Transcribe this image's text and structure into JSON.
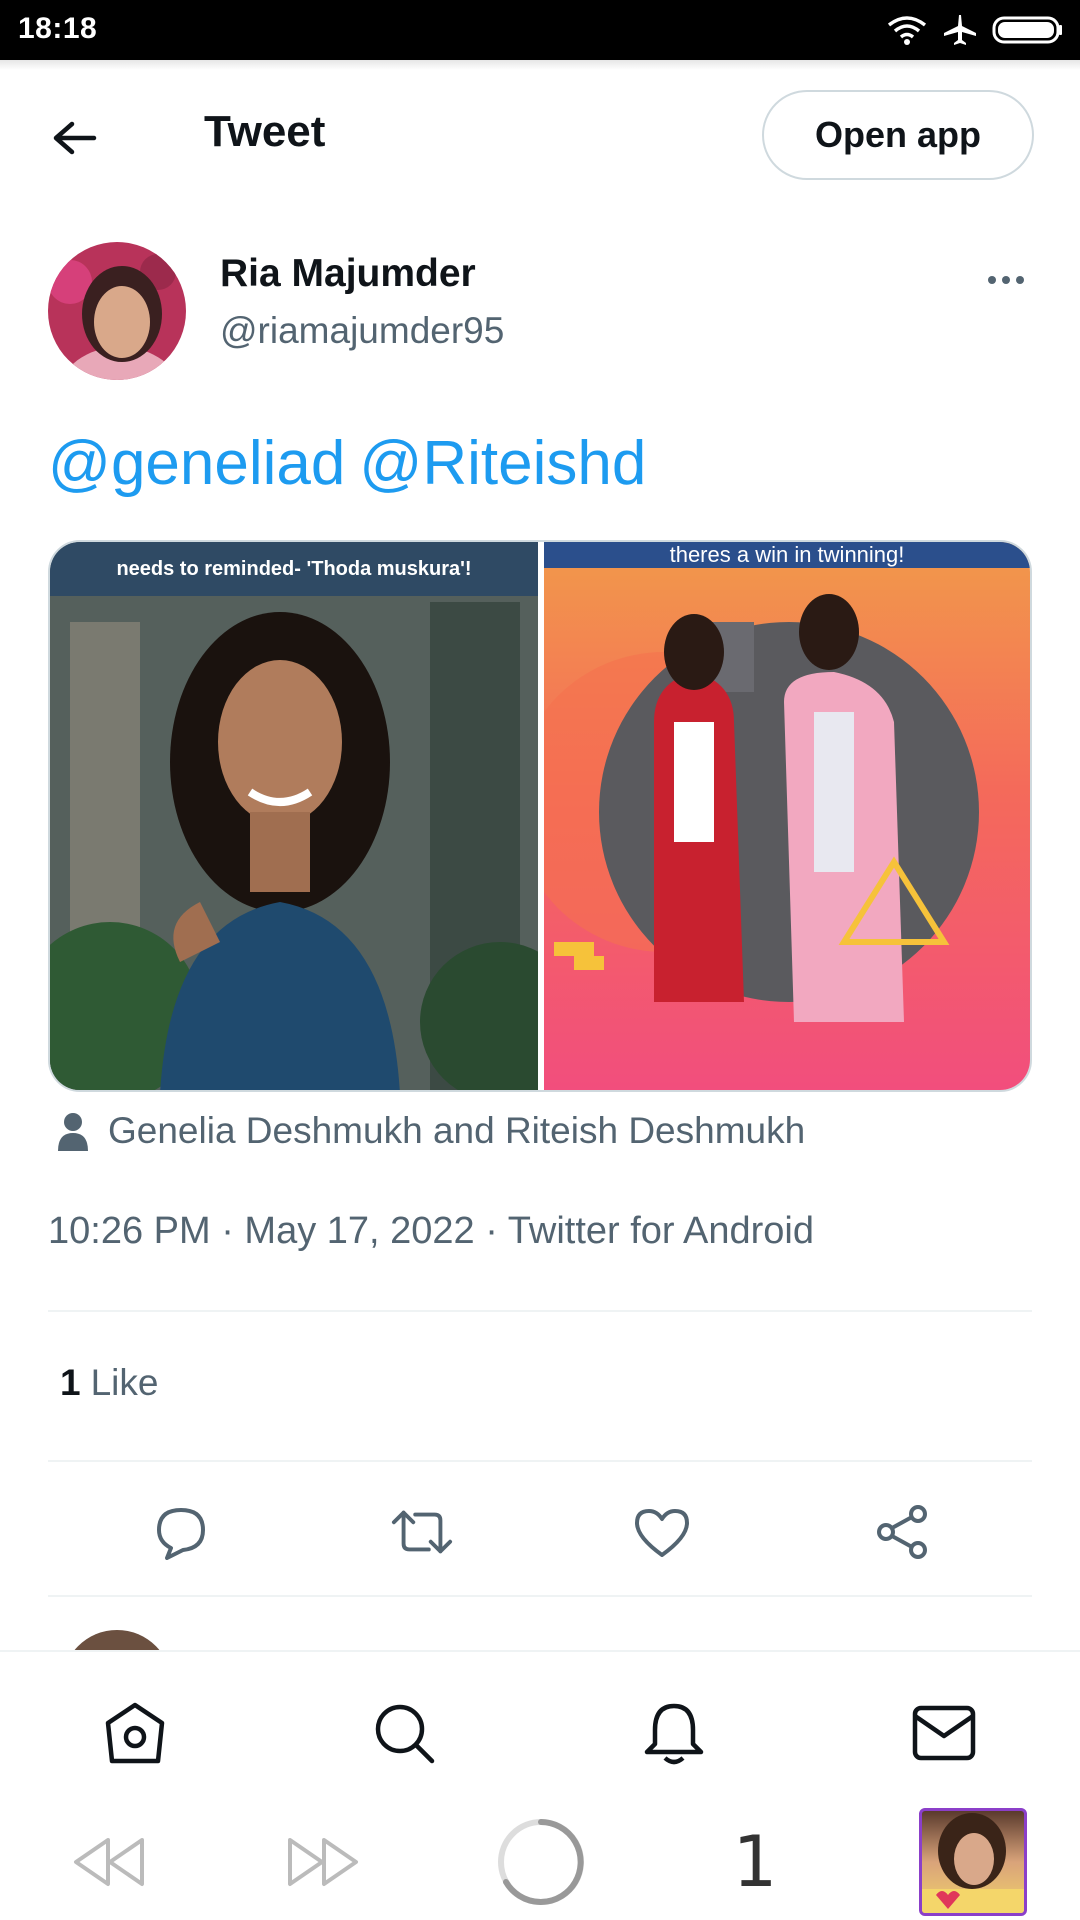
{
  "status_bar": {
    "time": "18:18"
  },
  "header": {
    "title": "Tweet",
    "open_app_label": "Open app"
  },
  "tweet": {
    "author_name": "Ria Majumder",
    "author_handle": "@riamajumder95",
    "mentions": [
      "@geneliad",
      "@Riteishd"
    ],
    "media": {
      "left_caption": "needs to reminded- 'Thoda muskura'!",
      "right_caption": "theres a win in twinning!"
    },
    "tagged_people": "Genelia Deshmukh and Riteish Deshmukh",
    "timestamp": "10:26 PM · May 17, 2022 · Twitter for Android",
    "likes_count": "1",
    "likes_label": "Like"
  },
  "browser_toolbar": {
    "tab_count": "1"
  },
  "colors": {
    "accent": "#1d9bf0",
    "secondary_text": "#536471",
    "primary_text": "#0f1419",
    "tab_border": "#8b3fc9"
  }
}
